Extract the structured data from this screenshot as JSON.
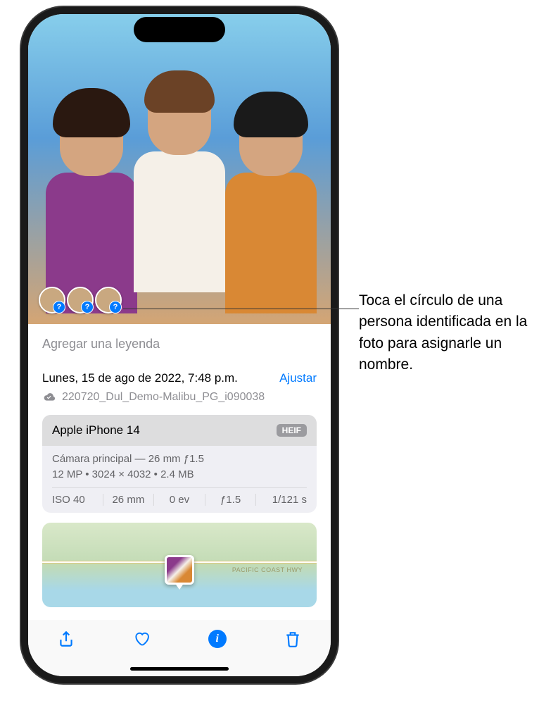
{
  "photo": {
    "caption_placeholder": "Agregar una leyenda",
    "face_circles_count": 3
  },
  "metadata": {
    "date_text": "Lunes, 15 de ago de 2022, 7:48 p.m.",
    "adjust_label": "Ajustar",
    "filename": "220720_Dul_Demo-Malibu_PG_i090038"
  },
  "camera": {
    "device": "Apple iPhone 14",
    "format_badge": "HEIF",
    "lens": "Cámara principal — 26 mm ƒ1.5",
    "specs": "12 MP  •  3024 × 4032  •  2.4 MB",
    "exif": {
      "iso": "ISO 40",
      "focal": "26 mm",
      "exposure_comp": "0 ev",
      "aperture": "ƒ1.5",
      "shutter": "1/121 s"
    }
  },
  "map": {
    "road_label": "PACIFIC COAST HWY"
  },
  "toolbar": {
    "share_label": "Compartir",
    "favorite_label": "Favorito",
    "info_label": "Información",
    "delete_label": "Eliminar"
  },
  "callout": {
    "text": "Toca el círculo de una persona identificada en la foto para asignarle un nombre."
  }
}
